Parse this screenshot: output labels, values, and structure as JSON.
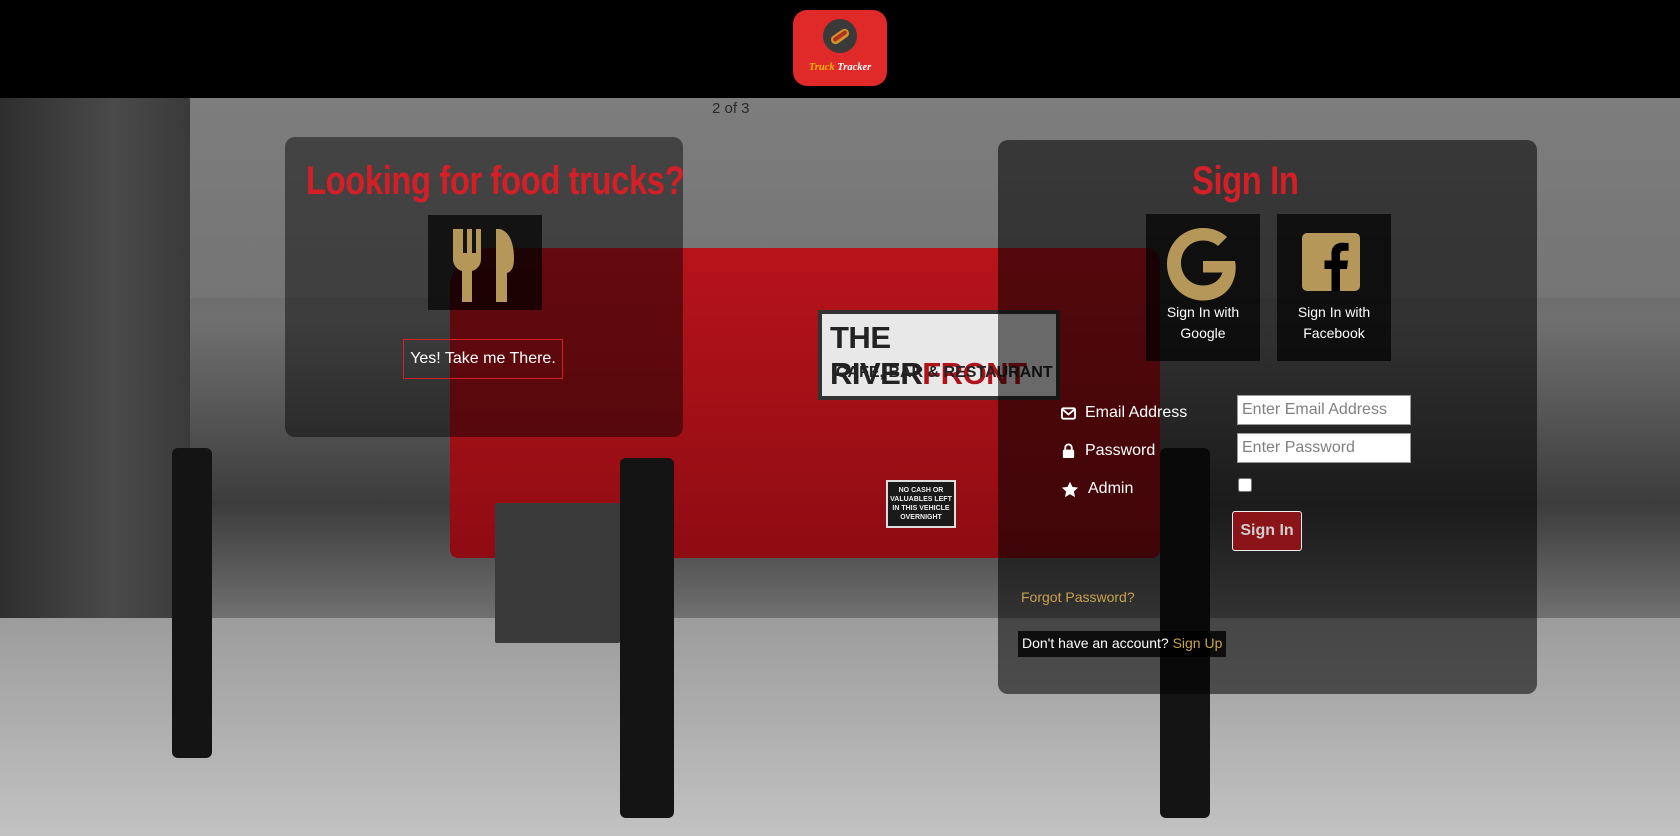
{
  "header": {
    "logo_word1": "Truck",
    "logo_word2": "Tracker"
  },
  "background": {
    "truck_sign_line1_a": "THE RIVER",
    "truck_sign_line1_b": "FRONT",
    "truck_sign_line2": "CAFE, BAR & RESTAURANT",
    "truck_note": "NO CASH OR VALUABLES LEFT IN THIS VEHICLE OVERNIGHT",
    "carousel_counter": "2 of 3"
  },
  "left_panel": {
    "heading": "Looking for food trucks?",
    "icon": "utensils-icon",
    "button_label": "Yes! Take me There."
  },
  "sign_in": {
    "heading": "Sign In",
    "google": {
      "icon": "google-icon",
      "line1": "Sign In with",
      "line2": "Google"
    },
    "facebook": {
      "icon": "facebook-icon",
      "line1": "Sign In with",
      "line2": "Facebook"
    },
    "email_label": "Email Address",
    "email_placeholder": "Enter Email Address",
    "password_label": "Password",
    "password_placeholder": "Enter Password",
    "admin_label": "Admin",
    "admin_checked": false,
    "submit_label": "Sign In",
    "forgot_label": "Forgot Password?",
    "signup_prompt": "Don't have an account?",
    "signup_link": "Sign Up"
  },
  "colors": {
    "accent_red": "#d41f26",
    "gold": "#c8a24d",
    "icon_gold": "#b5975a",
    "logo_bg": "#e02a2a"
  }
}
